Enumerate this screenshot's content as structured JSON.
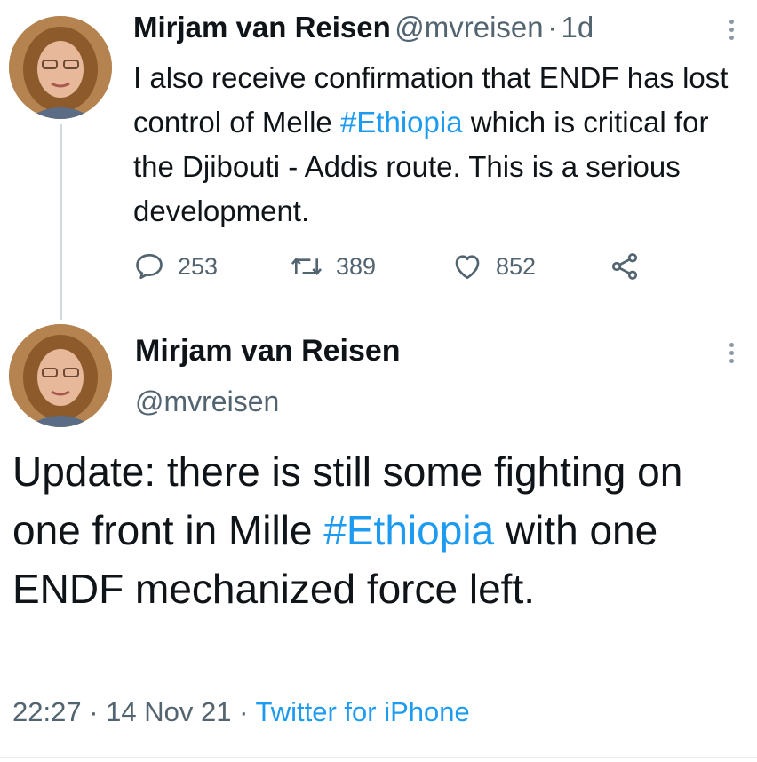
{
  "tweet1": {
    "author_name": "Mirjam van Reisen",
    "handle": "@mvreisen",
    "separator": "·",
    "age": "1d",
    "text_part1": "I also receive confirmation that ENDF has lost control of Melle ",
    "hashtag": "#Ethiopia",
    "text_part2": " which is critical for the Djibouti - Addis route. This is a serious development.",
    "replies": "253",
    "retweets": "389",
    "likes": "852"
  },
  "tweet2": {
    "author_name": "Mirjam van Reisen",
    "handle": "@mvreisen",
    "text_part1": "Update: there is still some fighting on one front in Mille ",
    "hashtag": "#Ethiopia",
    "text_part2": " with one ENDF mechanized force left.",
    "time": "22:27",
    "sep1": "·",
    "date": "14 Nov 21",
    "sep2": "·",
    "source": "Twitter for iPhone"
  },
  "colors": {
    "link": "#1d9bf0",
    "muted": "#536471",
    "text": "#0f1419",
    "thread_line": "#cfd9de"
  },
  "icons": [
    "reply-icon",
    "retweet-icon",
    "like-icon",
    "share-icon",
    "more-icon"
  ]
}
